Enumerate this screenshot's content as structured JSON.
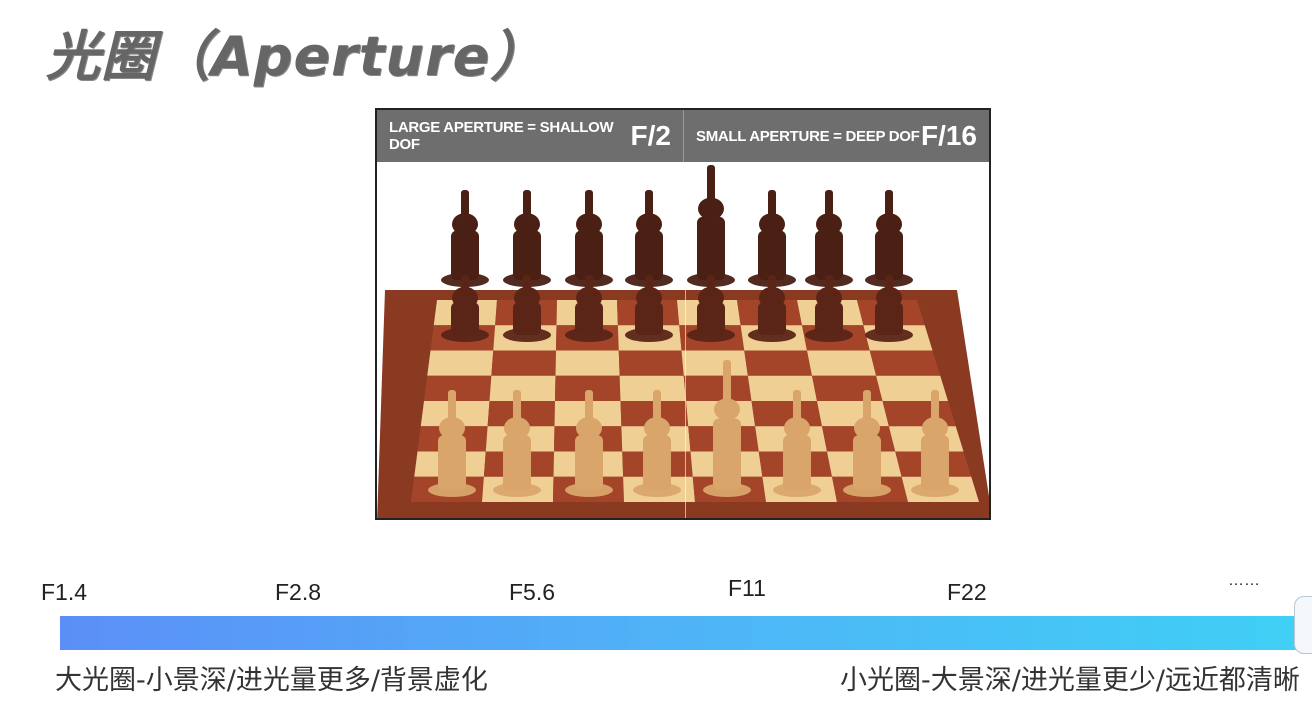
{
  "title": "光圈（Aperture）",
  "photo": {
    "left_banner": {
      "text": "LARGE APERTURE = SHALLOW DOF",
      "fstop": "F/2"
    },
    "right_banner": {
      "text": "SMALL APERTURE = DEEP DOF",
      "fstop": "F/16"
    },
    "colors": {
      "banner": "#6e6e6e",
      "dark_piece": "#4a1f14",
      "light_piece": "#d9a56a"
    }
  },
  "scale": {
    "stops": [
      "F1.4",
      "F2.8",
      "F5.6",
      "F11",
      "F22",
      "……"
    ],
    "colors": {
      "start": "#5b8ff7",
      "end": "#3fd0f5"
    }
  },
  "captions": {
    "left": "大光圈-小景深/进光量更多/背景虚化",
    "right": "小光圈-大景深/进光量更少/远近都清晰"
  }
}
